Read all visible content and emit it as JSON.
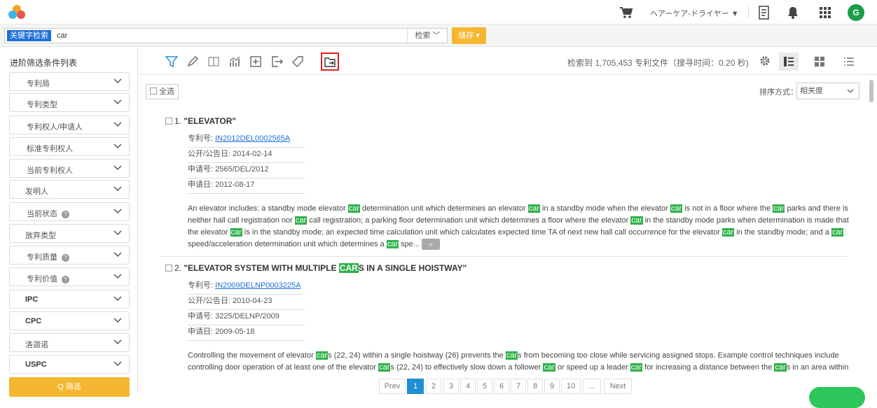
{
  "header": {
    "user_name": "ヘアーケア-ドライヤー ▼",
    "avatar_letter": "G"
  },
  "search": {
    "keyword_tag": "关键字检索",
    "query": "car",
    "search_button": "检索 ﹀",
    "save_button": "储存 ▾"
  },
  "sidebar": {
    "title": "进阶筛选条件列表",
    "items": [
      {
        "label": "专利局"
      },
      {
        "label": "专利类型"
      },
      {
        "label": "专利权人/申请人"
      },
      {
        "label": "标准专利权人"
      },
      {
        "label": "当前专利权人"
      },
      {
        "label": "发明人"
      },
      {
        "label": "当前状态"
      },
      {
        "label": "放弃类型"
      },
      {
        "label": "专利质量"
      },
      {
        "label": "专利价值"
      },
      {
        "label": "IPC"
      },
      {
        "label": "CPC"
      },
      {
        "label": "洛迦诺"
      },
      {
        "label": "USPC"
      }
    ],
    "help_mark": "?",
    "filter_button": "Q 筛选"
  },
  "toolbar": {
    "result_info": "检索到 1,705,453 专利文件（搜寻时间：0.20 秒)"
  },
  "content": {
    "select_all": "全选",
    "sort_label": "排序方式：",
    "sort_value": "相关度",
    "results": [
      {
        "num": "1.",
        "title": "\"ELEVATOR\"",
        "patent_no_label": "专利号:",
        "patent_no": "IN2012DEL0002565A",
        "pub_date": "公开/公告日: 2014-02-14",
        "app_no": "申请号: 2565/DEL/2012",
        "app_date": "申请日: 2012-08-17"
      },
      {
        "num": "2.",
        "title_pre": "\"ELEVATOR SYSTEM WITH MULTIPLE ",
        "title_hl": "CAR",
        "title_post": "S IN A SINGLE HOISTWAY\"",
        "patent_no_label": "专利号:",
        "patent_no": "IN2009DELNP0003225A",
        "pub_date": "公开/公告日: 2010-04-23",
        "app_no": "申请号: 3225/DELNP/2009",
        "app_date": "申请日: 2009-05-18"
      }
    ],
    "hl_word": "car"
  },
  "pager": {
    "prev": "Prev",
    "pages": [
      "1",
      "2",
      "3",
      "4",
      "5",
      "6",
      "7",
      "8",
      "9",
      "10",
      "..."
    ],
    "next": "Next"
  }
}
